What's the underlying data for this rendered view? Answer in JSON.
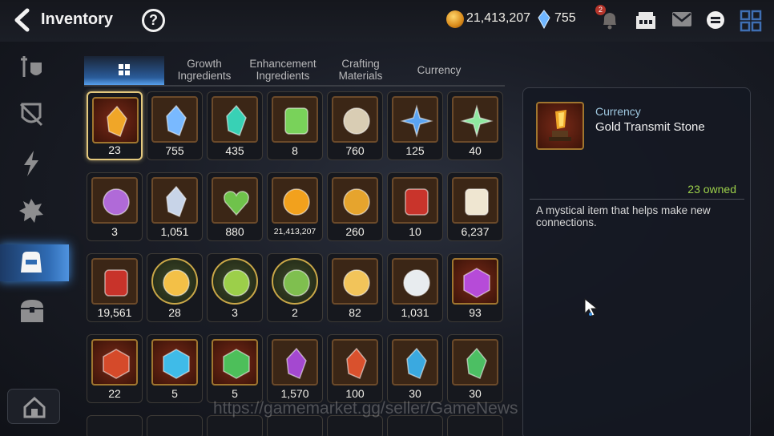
{
  "header": {
    "title": "Inventory",
    "help_icon": "?"
  },
  "currency": {
    "gold": "21,413,207",
    "crystals": "755",
    "notifications": "2"
  },
  "tabs": [
    "Growth\nIngredients",
    "Enhancement\nIngredients",
    "Crafting\nMaterials",
    "Currency"
  ],
  "items": [
    {
      "count": "23",
      "icon": "gold-transmit-stone-icon",
      "selected": true
    },
    {
      "count": "755",
      "icon": "blue-crystal-icon"
    },
    {
      "count": "435",
      "icon": "teal-crystal-icon"
    },
    {
      "count": "8",
      "icon": "green-leaf-icon"
    },
    {
      "count": "760",
      "icon": "silver-coin-icon"
    },
    {
      "count": "125",
      "icon": "blue-star-charm-icon"
    },
    {
      "count": "40",
      "icon": "green-star-charm-icon"
    },
    {
      "count": "3",
      "icon": "purple-seal-icon"
    },
    {
      "count": "1,051",
      "icon": "silver-shard-icon"
    },
    {
      "count": "880",
      "icon": "green-heart-icon"
    },
    {
      "count": "21,413,207",
      "icon": "gold-coin-icon"
    },
    {
      "count": "260",
      "icon": "gold-emblem-icon"
    },
    {
      "count": "10",
      "icon": "red-banner-icon"
    },
    {
      "count": "6,237",
      "icon": "chess-knight-icon"
    },
    {
      "count": "19,561",
      "icon": "red-mask-icon"
    },
    {
      "count": "28",
      "icon": "hamster-gold-icon"
    },
    {
      "count": "3",
      "icon": "hamster-green-icon"
    },
    {
      "count": "2",
      "icon": "hamster-leaf-icon"
    },
    {
      "count": "82",
      "icon": "gold-flower-icon"
    },
    {
      "count": "1,031",
      "icon": "white-flower-icon"
    },
    {
      "count": "93",
      "icon": "purple-moon-rune-icon"
    },
    {
      "count": "22",
      "icon": "red-fire-rune-icon"
    },
    {
      "count": "5",
      "icon": "blue-ice-rune-icon"
    },
    {
      "count": "5",
      "icon": "green-leaf-rune-icon"
    },
    {
      "count": "1,570",
      "icon": "purple-moon-shard-icon"
    },
    {
      "count": "100",
      "icon": "red-fire-shard-icon"
    },
    {
      "count": "30",
      "icon": "blue-ice-shard-icon"
    },
    {
      "count": "30",
      "icon": "green-leaf-shard-icon"
    }
  ],
  "detail": {
    "type": "Currency",
    "name": "Gold Transmit Stone",
    "owned": "23 owned",
    "description": "A mystical item that helps make new connections."
  },
  "watermark": "https://gamemarket.gg/seller/GameNews",
  "colors": {
    "accent": "#2f6bb3",
    "owned": "#9ccf4a",
    "selected": "#e4c97e"
  }
}
